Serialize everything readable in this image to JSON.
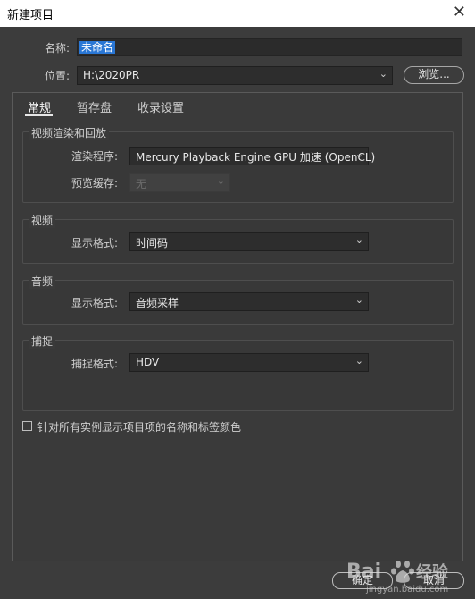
{
  "window": {
    "title": "新建项目",
    "close_glyph": "✕"
  },
  "name_row": {
    "label": "名称:",
    "value": "未命名"
  },
  "location_row": {
    "label": "位置:",
    "value": "H:\\2020PR",
    "browse_label": "浏览..."
  },
  "tabs": [
    {
      "label": "常规",
      "active": true
    },
    {
      "label": "暂存盘",
      "active": false
    },
    {
      "label": "收录设置",
      "active": false
    }
  ],
  "render_group": {
    "title": "视频渲染和回放",
    "renderer_label": "渲染程序:",
    "renderer_value": "Mercury Playback Engine GPU 加速 (OpenCL)",
    "preview_cache_label": "预览缓存:",
    "preview_cache_value": "无"
  },
  "video_group": {
    "title": "视频",
    "format_label": "显示格式:",
    "format_value": "时间码"
  },
  "audio_group": {
    "title": "音频",
    "format_label": "显示格式:",
    "format_value": "音频采样"
  },
  "capture_group": {
    "title": "捕捉",
    "format_label": "捕捉格式:",
    "format_value": "HDV"
  },
  "checkbox": {
    "label": "针对所有实例显示项目项的名称和标签颜色",
    "checked": false
  },
  "buttons": {
    "ok": "确定",
    "cancel": "取消"
  },
  "colors": {
    "background": "#3c3c3c",
    "selection": "#2a77d5",
    "titlebar": "#ffffff"
  },
  "watermark": {
    "brand": "Bai",
    "brand_suffix": "经验",
    "url": "jingyan.baidu.com"
  }
}
